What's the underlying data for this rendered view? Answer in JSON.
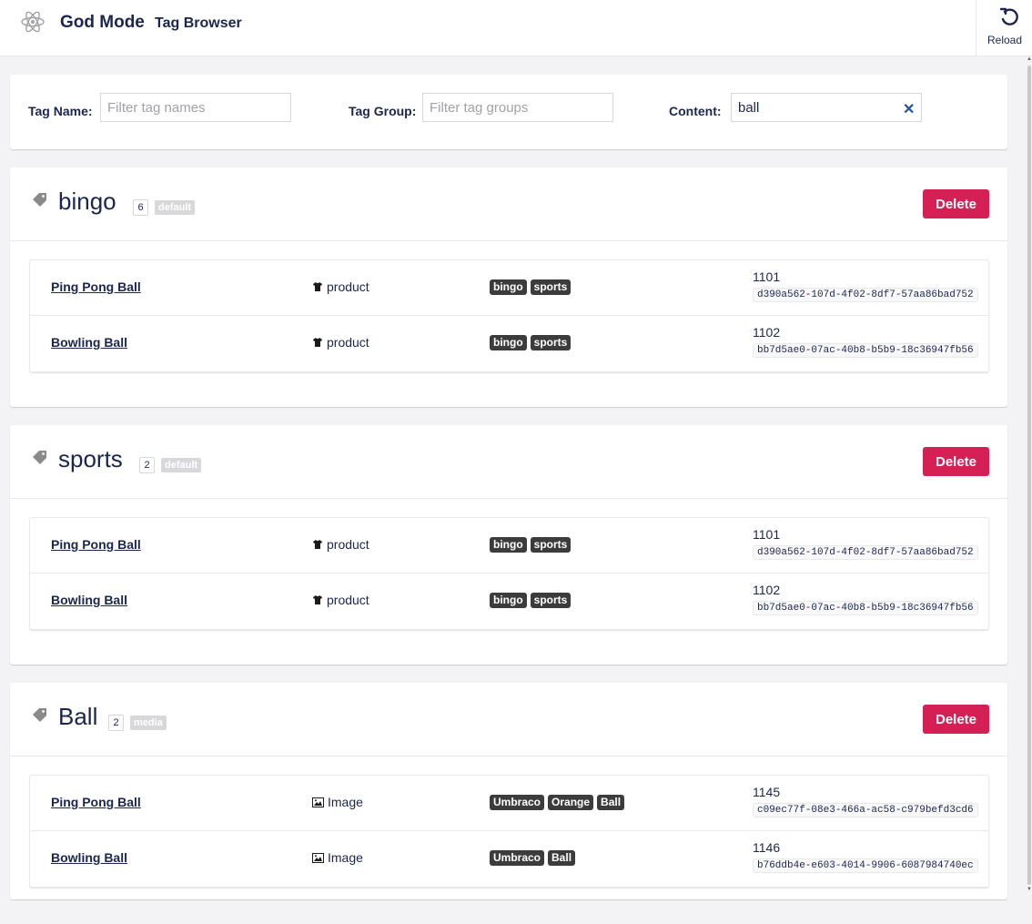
{
  "header": {
    "app_title": "God Mode",
    "subtitle": "Tag Browser",
    "reload_label": "Reload"
  },
  "filters": {
    "tag_name_label": "Tag Name:",
    "tag_name_placeholder": "Filter tag names",
    "tag_group_label": "Tag Group:",
    "tag_group_placeholder": "Filter tag groups",
    "content_label": "Content:",
    "content_value": "ball"
  },
  "tags": [
    {
      "name": "bingo",
      "count": "6",
      "group": "default",
      "delete_label": "Delete",
      "rows": [
        {
          "name": "Ping Pong Ball",
          "type": "product",
          "type_icon": "shirt-icon",
          "tags": [
            "bingo",
            "sports"
          ],
          "id": "1101",
          "guid": "d390a562-107d-4f02-8df7-57aa86bad752"
        },
        {
          "name": "Bowling Ball",
          "type": "product",
          "type_icon": "shirt-icon",
          "tags": [
            "bingo",
            "sports"
          ],
          "id": "1102",
          "guid": "bb7d5ae0-07ac-40b8-b5b9-18c36947fb56"
        }
      ]
    },
    {
      "name": "sports",
      "count": "2",
      "group": "default",
      "delete_label": "Delete",
      "rows": [
        {
          "name": "Ping Pong Ball",
          "type": "product",
          "type_icon": "shirt-icon",
          "tags": [
            "bingo",
            "sports"
          ],
          "id": "1101",
          "guid": "d390a562-107d-4f02-8df7-57aa86bad752"
        },
        {
          "name": "Bowling Ball",
          "type": "product",
          "type_icon": "shirt-icon",
          "tags": [
            "bingo",
            "sports"
          ],
          "id": "1102",
          "guid": "bb7d5ae0-07ac-40b8-b5b9-18c36947fb56"
        }
      ]
    },
    {
      "name": "Ball",
      "count": "2",
      "group": "media",
      "delete_label": "Delete",
      "rows": [
        {
          "name": "Ping Pong Ball",
          "type": "Image",
          "type_icon": "picture-icon",
          "tags": [
            "Umbraco",
            "Orange",
            "Ball"
          ],
          "id": "1145",
          "guid": "c09ec77f-08e3-466a-ac58-c979befd3cd6"
        },
        {
          "name": "Bowling Ball",
          "type": "Image",
          "type_icon": "picture-icon",
          "tags": [
            "Umbraco",
            "Ball"
          ],
          "id": "1146",
          "guid": "b76ddb4e-e603-4014-9906-6087984740ec"
        }
      ]
    }
  ],
  "colors": {
    "delete": "#d42054",
    "chip": "#3c3c3c",
    "text": "#1b264f"
  }
}
